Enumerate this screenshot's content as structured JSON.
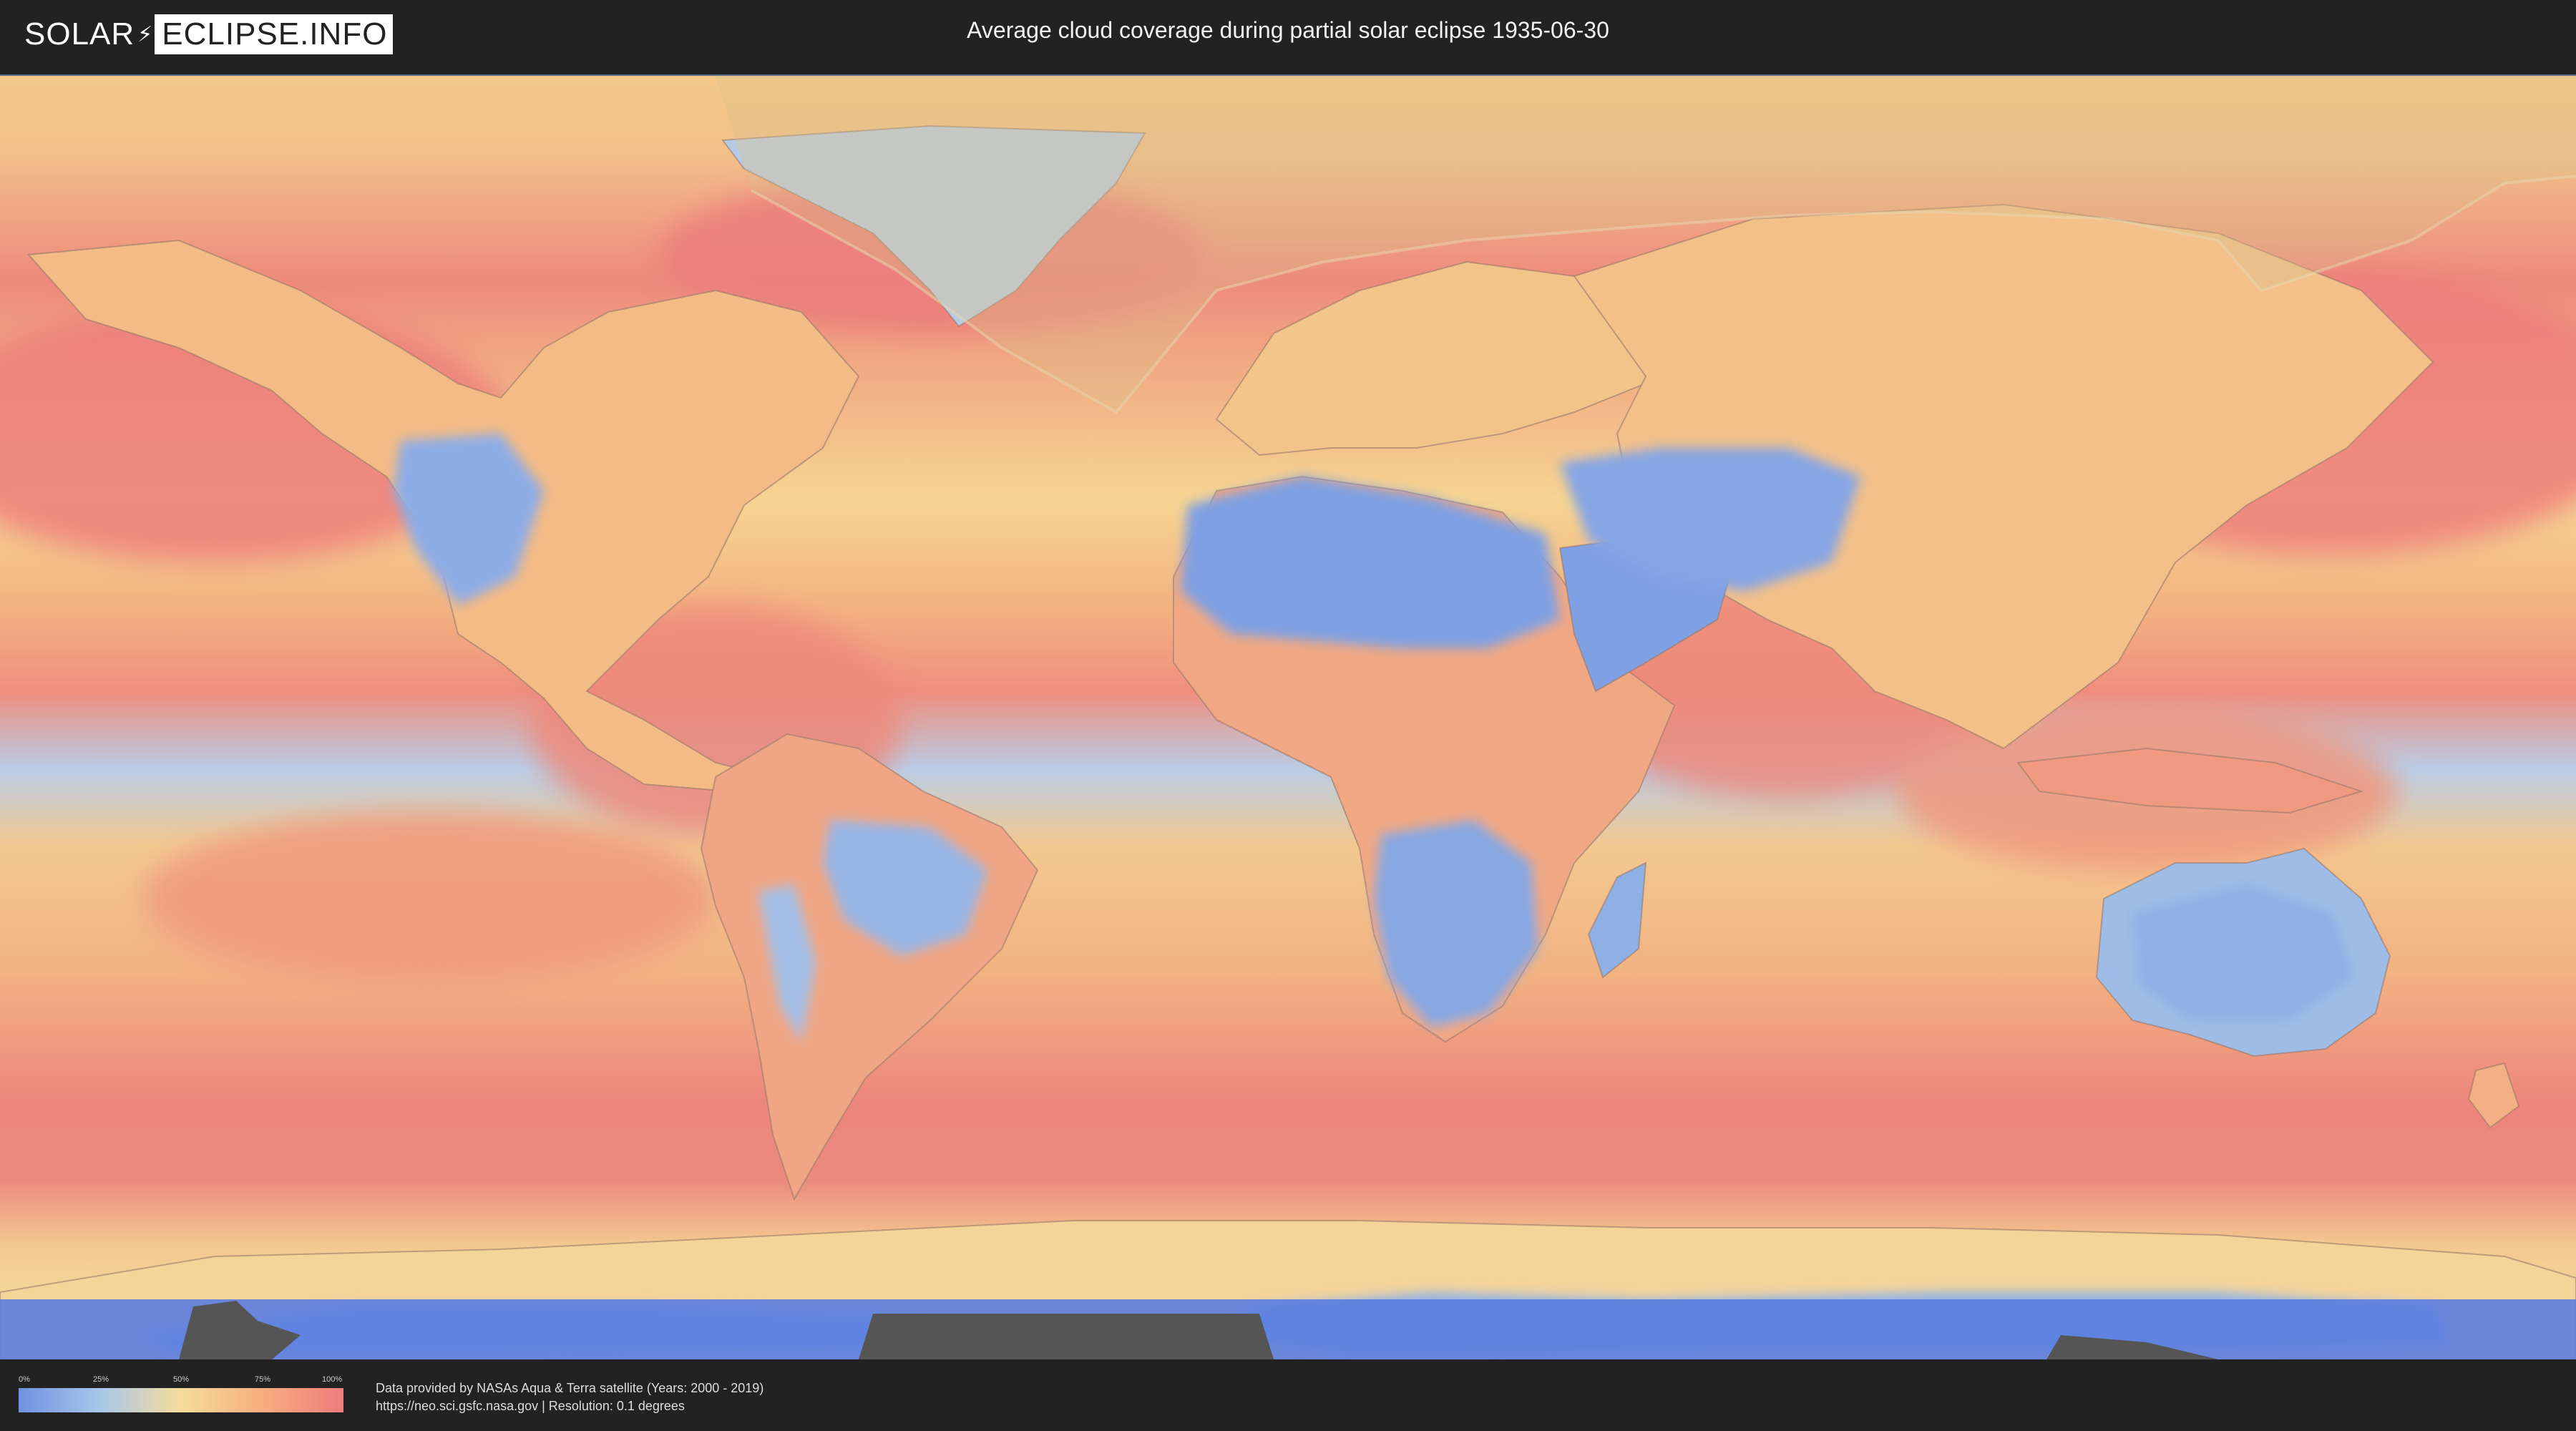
{
  "header": {
    "logo_part1": "SOLAR",
    "logo_separator": "⚡",
    "logo_part2": "ECLIPSE.INFO",
    "title": "Average cloud coverage during partial solar eclipse 1935-06-30"
  },
  "legend": {
    "ticks": [
      "0%",
      "25%",
      "50%",
      "75%",
      "100%"
    ],
    "colors": [
      "#6f92e0",
      "#a7c7ea",
      "#f6dc9c",
      "#f6ae7e",
      "#f07c7c"
    ]
  },
  "credits": {
    "line1": "Data provided by NASAs Aqua & Terra satellite (Years: 2000 - 2019)",
    "line2": "https://neo.sci.gsfc.nasa.gov | Resolution: 0.1 degrees"
  },
  "map": {
    "map_name": "world-cloud-coverage-map",
    "ocean_color": "#f0a080",
    "cloudy_color": "#ee7e7c",
    "clear_color": "#7fa0e2",
    "polar_color": "#5d7fe0",
    "eclipse_overlay_color": "#d9c08a"
  }
}
